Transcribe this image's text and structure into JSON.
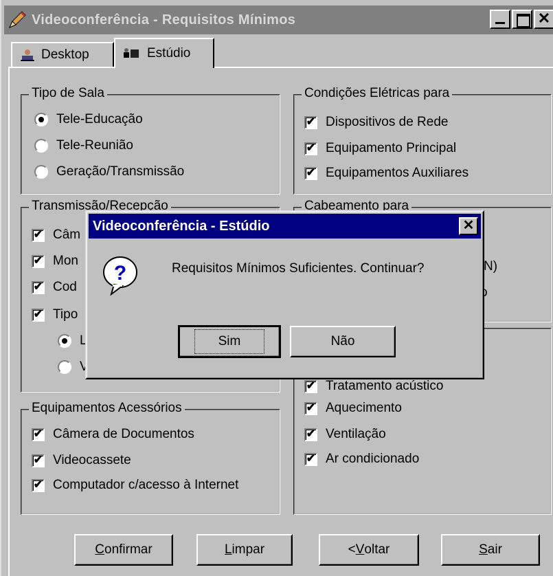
{
  "window": {
    "title": "Videoconferência - Requisitos Mínimos"
  },
  "tabs": [
    {
      "label": "Desktop",
      "icon": "desktop-icon"
    },
    {
      "label": "Estúdio",
      "icon": "studio-icon"
    }
  ],
  "tipo_sala": {
    "title": "Tipo de Sala",
    "options": [
      "Tele-Educação",
      "Tele-Reunião",
      "Geração/Transmissão"
    ],
    "selected": "Tele-Educação"
  },
  "condicoes": {
    "title": "Condições Elétricas para",
    "items": [
      "Dispositivos de Rede",
      "Equipamento Principal",
      "Equipamentos Auxiliares"
    ]
  },
  "transmissao": {
    "title": "Transmissão/Recepção",
    "items": [
      "Câm",
      "Mon",
      "Cod",
      "Tipo"
    ],
    "radio_items": [
      "L",
      "V"
    ]
  },
  "cabeamento": {
    "title": "Cabeamento para",
    "partial": [
      "N)",
      "o"
    ]
  },
  "ambiente": {
    "items": [
      "Tratamento acústico",
      "Aquecimento",
      "Ventilação",
      "Ar condicionado"
    ]
  },
  "acessorios": {
    "title": "Equipamentos Acessórios",
    "items": [
      "Câmera de Documentos",
      "Videocassete",
      "Computador c/acesso à Internet"
    ]
  },
  "buttons": {
    "confirmar": {
      "pre": "",
      "u": "C",
      "post": "onfirmar"
    },
    "limpar": {
      "pre": "",
      "u": "L",
      "post": "impar"
    },
    "voltar": {
      "pre": "<",
      "u": "V",
      "post": "oltar"
    },
    "sair": {
      "pre": "",
      "u": "S",
      "post": "air"
    }
  },
  "dialog": {
    "title": "Videoconferência - Estúdio",
    "message": "Requisitos Mínimos Suficientes. Continuar?",
    "icon": "question-icon",
    "yes": "Sim",
    "no": "Não"
  },
  "colors": {
    "face": "#c0c0c0",
    "dialog_title": "#000080",
    "inactive_title": "#808080"
  }
}
